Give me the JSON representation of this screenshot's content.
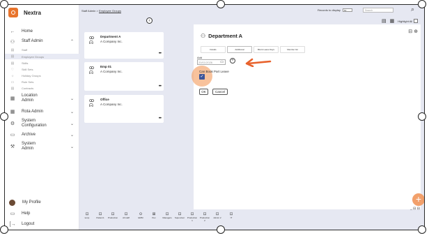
{
  "app": {
    "name": "Nextra"
  },
  "sidebar": {
    "items": [
      {
        "label": "Home",
        "icon": "arrow-left-icon",
        "glyph": "←"
      },
      {
        "label": "Staff Admin",
        "icon": "users-icon",
        "glyph": "⚇"
      },
      {
        "label": "Staff",
        "icon": "staff-icon",
        "glyph": "▤"
      },
      {
        "label": "Employee Groups",
        "icon": "groups-icon",
        "glyph": "▤"
      },
      {
        "label": "Skills",
        "icon": "skills-icon",
        "glyph": "▤"
      },
      {
        "label": "Skill Sets",
        "icon": "skillsets-icon",
        "glyph": "♡"
      },
      {
        "label": "Holiday Groups",
        "icon": "holiday-icon",
        "glyph": "☼"
      },
      {
        "label": "Rule Sets",
        "icon": "rules-icon",
        "glyph": "▭"
      },
      {
        "label": "Contracts",
        "icon": "contracts-icon",
        "glyph": "▤"
      },
      {
        "label": "Location Admin",
        "icon": "location-icon",
        "glyph": "▦"
      },
      {
        "label": "Rota Admin",
        "icon": "rota-icon",
        "glyph": "▦"
      },
      {
        "label": "System Configuration",
        "icon": "config-icon",
        "glyph": "⚙"
      },
      {
        "label": "Archive",
        "icon": "archive-icon",
        "glyph": "▭"
      },
      {
        "label": "System Admin",
        "icon": "wrench-icon",
        "glyph": "⚒"
      }
    ],
    "footer": [
      {
        "label": "My Profile"
      },
      {
        "label": "Help",
        "glyph": "▭"
      },
      {
        "label": "Logout",
        "glyph": "[→"
      }
    ]
  },
  "topbar": {
    "breadcrumb_root": "Staff Admin",
    "breadcrumb_sep": ">",
    "breadcrumb_current": "Employee Groups",
    "records_label": "Records to display",
    "records_value": "50",
    "search_placeholder": "Search",
    "highlight_label": "Highlight All"
  },
  "groups": [
    {
      "name": "Department A",
      "company": "A Company Inc."
    },
    {
      "name": "Emp 01",
      "company": "A Company Inc."
    },
    {
      "name": "Office",
      "company": "A Company Inc."
    }
  ],
  "detail": {
    "title": "Department A",
    "tabs": [
      "Details",
      "Additional",
      "Block Leave Days",
      "Member list"
    ],
    "add_label": "Add",
    "date_value": "20/01/2026",
    "checkbox_label": "Can Book Part Leave",
    "checkbox_checked": true,
    "ok_label": "OK",
    "cancel_label": "Cancel"
  },
  "bottom_bar": [
    {
      "label": "temp"
    },
    {
      "label": "Pattern1"
    },
    {
      "label": "Production"
    },
    {
      "label": "All staff"
    },
    {
      "label": "EMM"
    },
    {
      "label": "Pex"
    },
    {
      "label": "Managers"
    },
    {
      "label": "Supervisor"
    },
    {
      "label": "Production 1"
    },
    {
      "label": "Production 2"
    },
    {
      "label": "Admin 2"
    },
    {
      "label": "IT"
    }
  ],
  "colors": {
    "accent": "#e8742c",
    "checkbox": "#3d5599",
    "background": "#e6e8f2"
  }
}
